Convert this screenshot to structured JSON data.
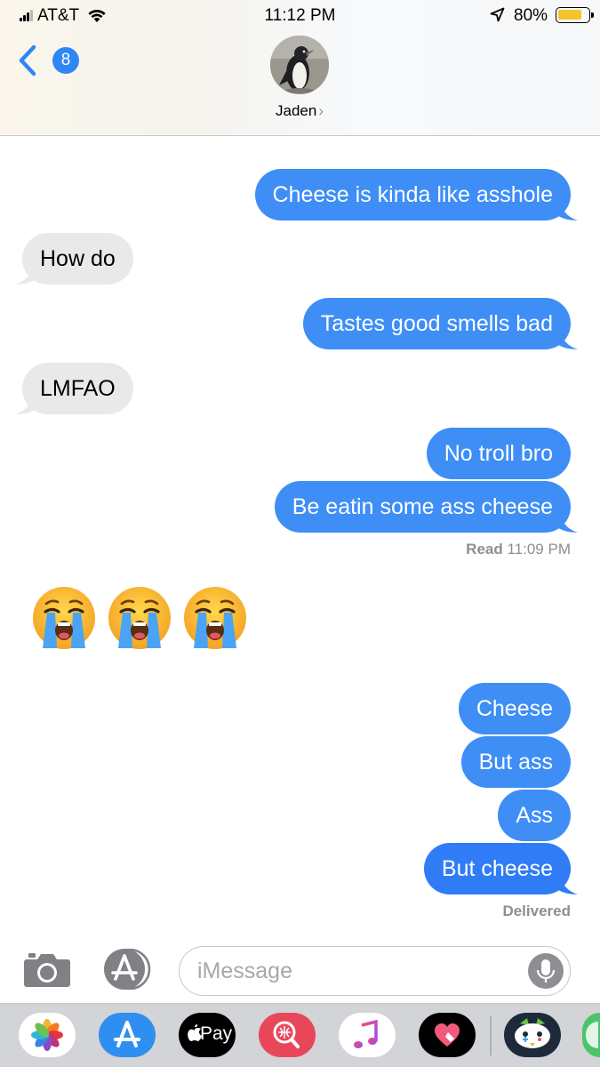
{
  "status_bar": {
    "carrier": "AT&T",
    "time": "11:12 PM",
    "battery_percent": "80%",
    "battery_level": 0.8,
    "icons": [
      "signal-icon",
      "wifi-icon",
      "location-arrow-icon",
      "battery-icon"
    ]
  },
  "header": {
    "back_badge": "8",
    "contact_name": "Jaden",
    "contact_chevron": "›"
  },
  "messages": [
    {
      "dir": "sent",
      "text": "Cheese is kinda like asshole"
    },
    {
      "dir": "received",
      "text": "How do"
    },
    {
      "dir": "sent",
      "text": "Tastes good smells bad"
    },
    {
      "dir": "received",
      "text": "LMFAO"
    },
    {
      "dir": "sent",
      "text": "No troll bro"
    },
    {
      "dir": "sent",
      "text": "Be eatin some ass cheese"
    },
    {
      "dir": "received",
      "emoji": [
        "loudly-crying-face",
        "loudly-crying-face",
        "loudly-crying-face"
      ]
    },
    {
      "dir": "sent",
      "text": "Cheese"
    },
    {
      "dir": "sent",
      "text": "But ass"
    },
    {
      "dir": "sent",
      "text": "Ass"
    },
    {
      "dir": "sent",
      "text": "But cheese"
    }
  ],
  "receipts": {
    "read_label": "Read",
    "read_time": "11:09 PM",
    "delivered": "Delivered"
  },
  "composer": {
    "placeholder": "iMessage",
    "icons": [
      "camera-icon",
      "app-store-icon",
      "microphone-icon"
    ]
  },
  "app_drawer": {
    "apple_pay_label": "Pay",
    "apps": [
      "photos-icon",
      "app-store-icon",
      "apple-pay-icon",
      "web-search-icon",
      "music-icon",
      "digital-touch-icon",
      "game-icon",
      "more-app-icon"
    ]
  },
  "colors": {
    "sent_bubble": "#3e8ef6",
    "received_bubble": "#e9e9eb",
    "accent": "#2f86f6"
  }
}
